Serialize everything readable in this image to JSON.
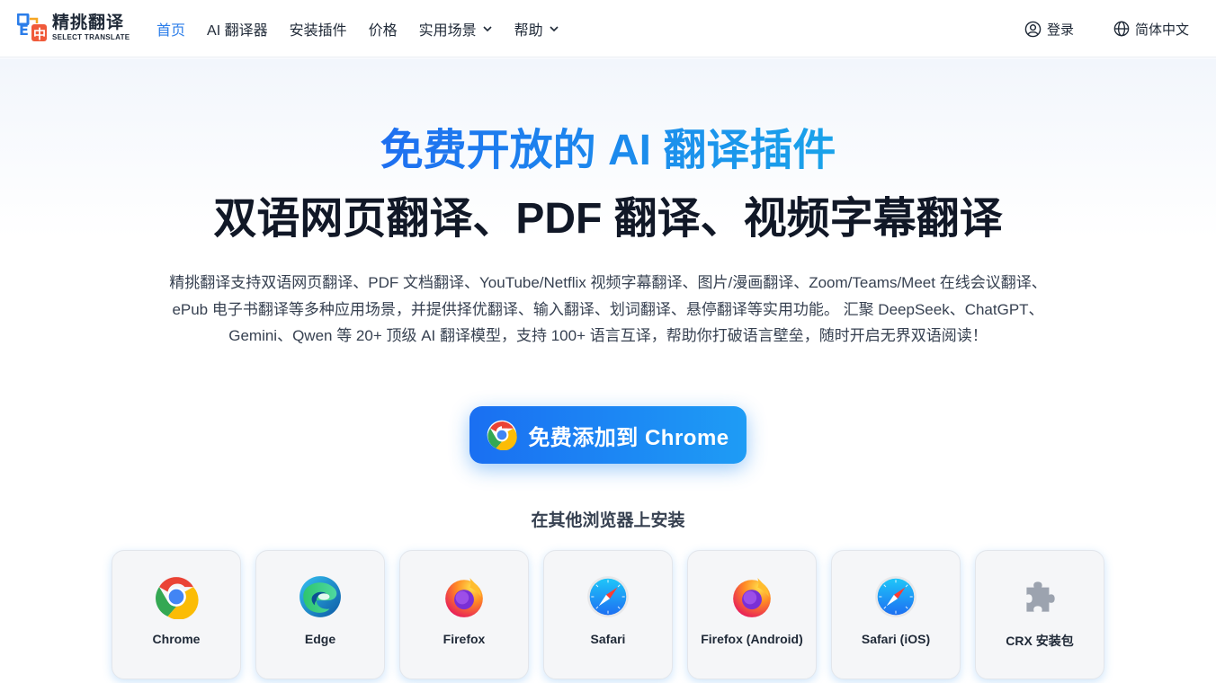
{
  "header": {
    "logo": {
      "cn": "精挑翻译",
      "en": "SELECT TRANSLATE"
    },
    "nav": [
      {
        "label": "首页",
        "active": true
      },
      {
        "label": "AI 翻译器"
      },
      {
        "label": "安装插件"
      },
      {
        "label": "价格"
      },
      {
        "label": "实用场景",
        "dropdown": true
      },
      {
        "label": "帮助",
        "dropdown": true
      }
    ],
    "login_label": "登录",
    "language_label": "简体中文"
  },
  "hero": {
    "title_highlight": "免费开放的 AI 翻译插件",
    "title_main": "双语网页翻译、PDF 翻译、视频字幕翻译",
    "description": "精挑翻译支持双语网页翻译、PDF 文档翻译、YouTube/Netflix 视频字幕翻译、图片/漫画翻译、Zoom/Teams/Meet 在线会议翻译、ePub 电子书翻译等多种应用场景，并提供择优翻译、输入翻译、划词翻译、悬停翻译等实用功能。 汇聚 DeepSeek、ChatGPT、Gemini、Qwen 等 20+ 顶级 AI 翻译模型，支持 100+ 语言互译，帮助你打破语言壁垒，随时开启无界双语阅读！",
    "cta_label": "免费添加到 Chrome"
  },
  "other_browsers": {
    "title": "在其他浏览器上安装",
    "items": [
      {
        "label": "Chrome",
        "icon": "chrome-icon"
      },
      {
        "label": "Edge",
        "icon": "edge-icon"
      },
      {
        "label": "Firefox",
        "icon": "firefox-icon"
      },
      {
        "label": "Safari",
        "icon": "safari-icon"
      },
      {
        "label": "Firefox (Android)",
        "icon": "firefox-icon"
      },
      {
        "label": "Safari (iOS)",
        "icon": "safari-icon"
      },
      {
        "label": "CRX 安装包",
        "icon": "puzzle-icon"
      }
    ]
  },
  "colors": {
    "accent": "#2b7de9",
    "cta_start": "#1a6ff2",
    "cta_end": "#1e9cf5"
  }
}
